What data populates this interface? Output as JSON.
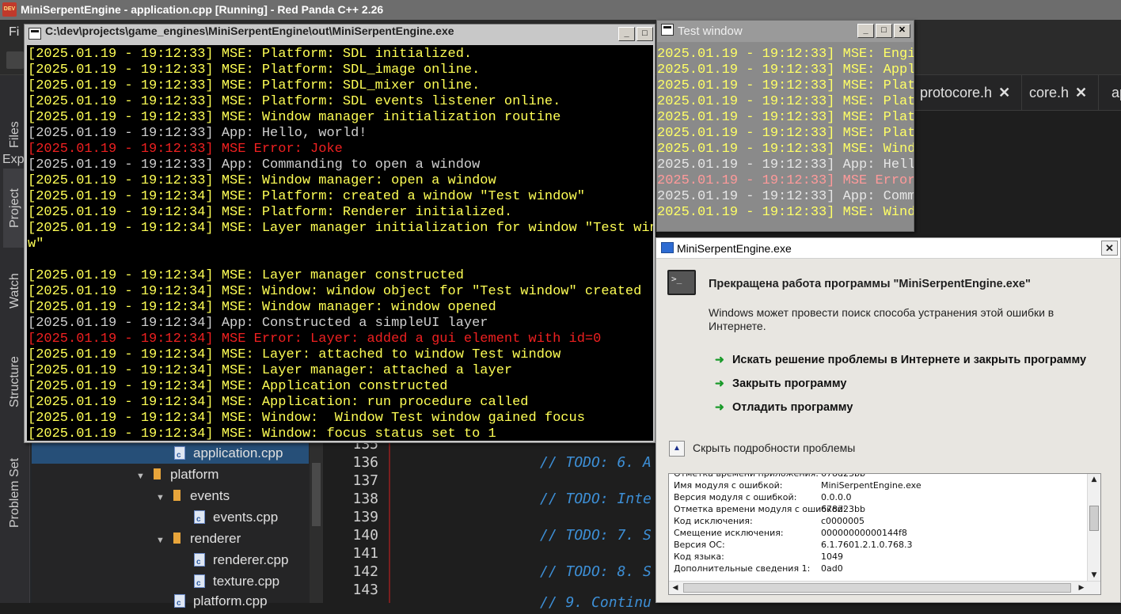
{
  "ide": {
    "title": "MiniSerpentEngine - application.cpp [Running] - Red Panda C++ 2.26",
    "menu_first": "Fi",
    "explorer_label": "Exp",
    "side_tabs": [
      "Files",
      "Project",
      "Watch",
      "Structure",
      "Problem Set"
    ],
    "tree": [
      {
        "label": "application.cpp",
        "kind": "file",
        "selected": true
      },
      {
        "label": "platform",
        "kind": "folder",
        "expanded": true
      },
      {
        "label": "events",
        "kind": "folder",
        "expanded": true
      },
      {
        "label": "events.cpp",
        "kind": "file"
      },
      {
        "label": "renderer",
        "kind": "folder",
        "expanded": true
      },
      {
        "label": "renderer.cpp",
        "kind": "file"
      },
      {
        "label": "texture.cpp",
        "kind": "file"
      },
      {
        "label": "platform.cpp",
        "kind": "file"
      }
    ],
    "tabs": [
      {
        "label": "protocore.h",
        "close": "✕"
      },
      {
        "label": "core.h",
        "close": "✕"
      },
      {
        "label": "ap",
        "close": ""
      }
    ],
    "line_numbers": [
      "135",
      "136",
      "137",
      "138",
      "139",
      "140",
      "141",
      "142",
      "143"
    ],
    "code": [
      {
        "line": "136",
        "text": "// TODO: 6. A"
      },
      {
        "line": "138",
        "text": "// TODO: Inte"
      },
      {
        "line": "140",
        "text": "// TODO: 7. S"
      },
      {
        "line": "142",
        "text": "// TODO: 8. S"
      },
      {
        "line": "144",
        "text": "// 9. Continu"
      }
    ],
    "tree_arrow_expanded": "▼"
  },
  "console": {
    "title": "C:\\dev\\projects\\game_engines\\MiniSerpentEngine\\out\\MiniSerpentEngine.exe",
    "lines": [
      {
        "text": "[2025.01.19 - 19:12:33] MSE: Platform: SDL initialized.",
        "kind": "y"
      },
      {
        "text": "[2025.01.19 - 19:12:33] MSE: Platform: SDL_image online.",
        "kind": "y"
      },
      {
        "text": "[2025.01.19 - 19:12:33] MSE: Platform: SDL_mixer online.",
        "kind": "y"
      },
      {
        "text": "[2025.01.19 - 19:12:33] MSE: Platform: SDL events listener online.",
        "kind": "y"
      },
      {
        "text": "[2025.01.19 - 19:12:33] MSE: Window manager initialization routine",
        "kind": "y"
      },
      {
        "text": "[2025.01.19 - 19:12:33] App: Hello, world!",
        "kind": "g"
      },
      {
        "text": "[2025.01.19 - 19:12:33] MSE Error: Joke",
        "kind": "r"
      },
      {
        "text": "[2025.01.19 - 19:12:33] App: Commanding to open a window",
        "kind": "g"
      },
      {
        "text": "[2025.01.19 - 19:12:33] MSE: Window manager: open a window",
        "kind": "y"
      },
      {
        "text": "[2025.01.19 - 19:12:34] MSE: Platform: created a window \"Test window\"",
        "kind": "y"
      },
      {
        "text": "[2025.01.19 - 19:12:34] MSE: Platform: Renderer initialized.",
        "kind": "y"
      },
      {
        "text": "[2025.01.19 - 19:12:34] MSE: Layer manager initialization for window \"Test windo",
        "kind": "y"
      },
      {
        "text": "w\"",
        "kind": "y"
      },
      {
        "text": "",
        "kind": "y"
      },
      {
        "text": "[2025.01.19 - 19:12:34] MSE: Layer manager constructed",
        "kind": "y"
      },
      {
        "text": "[2025.01.19 - 19:12:34] MSE: Window: window object for \"Test window\" created",
        "kind": "y"
      },
      {
        "text": "[2025.01.19 - 19:12:34] MSE: Window manager: window opened",
        "kind": "y"
      },
      {
        "text": "[2025.01.19 - 19:12:34] App: Constructed a simpleUI layer",
        "kind": "g"
      },
      {
        "text": "[2025.01.19 - 19:12:34] MSE Error: Layer: added a gui element with id=0",
        "kind": "r"
      },
      {
        "text": "[2025.01.19 - 19:12:34] MSE: Layer: attached to window Test window",
        "kind": "y"
      },
      {
        "text": "[2025.01.19 - 19:12:34] MSE: Layer manager: attached a layer",
        "kind": "y"
      },
      {
        "text": "[2025.01.19 - 19:12:34] MSE: Application constructed",
        "kind": "y"
      },
      {
        "text": "[2025.01.19 - 19:12:34] MSE: Application: run procedure called",
        "kind": "y"
      },
      {
        "text": "[2025.01.19 - 19:12:34] MSE: Window:  Window Test window gained focus",
        "kind": "y"
      },
      {
        "text": "[2025.01.19 - 19:12:34] MSE: Window: focus status set to 1",
        "kind": "y"
      }
    ]
  },
  "test_window": {
    "title": "Test window",
    "lines": [
      {
        "text": "2025.01.19 - 19:12:33] MSE: Engin",
        "kind": "y"
      },
      {
        "text": "2025.01.19 - 19:12:33] MSE: Appli",
        "kind": "y"
      },
      {
        "text": "2025.01.19 - 19:12:33] MSE: Platf",
        "kind": "y"
      },
      {
        "text": "2025.01.19 - 19:12:33] MSE: Platf",
        "kind": "y"
      },
      {
        "text": "2025.01.19 - 19:12:33] MSE: Platf",
        "kind": "y"
      },
      {
        "text": "2025.01.19 - 19:12:33] MSE: Platf",
        "kind": "y"
      },
      {
        "text": "2025.01.19 - 19:12:33] MSE: Windo",
        "kind": "y"
      },
      {
        "text": "2025.01.19 - 19:12:33] App: Hello",
        "kind": "g"
      },
      {
        "text": "2025.01.19 - 19:12:33] MSE Error:",
        "kind": "r"
      },
      {
        "text": "2025.01.19 - 19:12:33] App: Comma",
        "kind": "g"
      },
      {
        "text": "2025.01.19 - 19:12:33] MSE: Windo",
        "kind": "y"
      }
    ]
  },
  "error_dialog": {
    "title": "MiniSerpentEngine.exe",
    "heading": "Прекращена работа программы \"MiniSerpentEngine.exe\"",
    "text": "Windows может провести поиск способа устранения этой ошибки в Интернете.",
    "actions": [
      "Искать решение проблемы в Интернете и закрыть программу",
      "Закрыть программу",
      "Отладить программу"
    ],
    "details_toggle": "Скрыть подробности проблемы",
    "details": [
      {
        "key": "Отметка времени приложения:",
        "value": "678d23bb"
      },
      {
        "key": "Имя модуля с ошибкой:",
        "value": "MiniSerpentEngine.exe"
      },
      {
        "key": "Версия модуля с ошибкой:",
        "value": "0.0.0.0"
      },
      {
        "key": "Отметка времени модуля с ошибкой:",
        "value": "678d23bb"
      },
      {
        "key": "Код исключения:",
        "value": "c0000005"
      },
      {
        "key": "Смещение исключения:",
        "value": "00000000000144f8"
      },
      {
        "key": "Версия ОС:",
        "value": "6.1.7601.2.1.0.768.3"
      },
      {
        "key": "Код языка:",
        "value": "1049"
      },
      {
        "key": "Дополнительные сведения 1:",
        "value": "0ad0"
      }
    ],
    "close_glyph": "✕"
  },
  "window_buttons": {
    "minimize": "_",
    "maximize": "□",
    "close": "✕"
  }
}
